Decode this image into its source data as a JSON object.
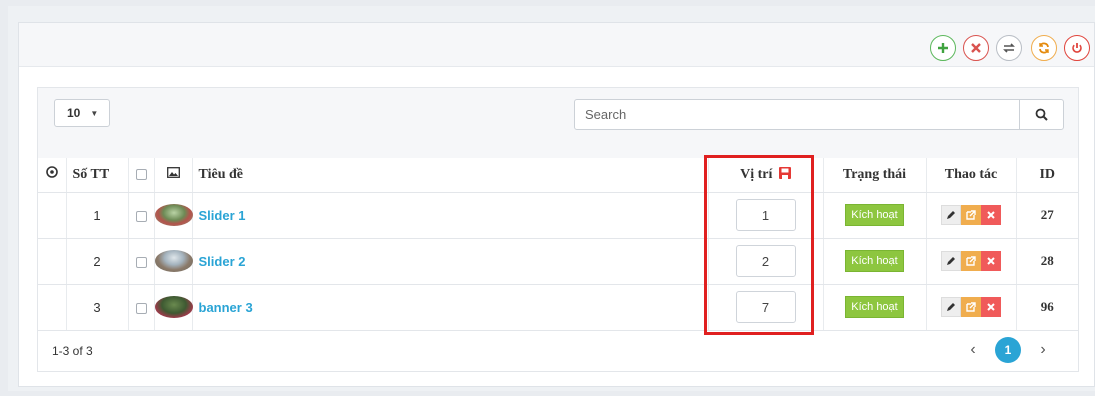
{
  "toolbar": {
    "buttons": [
      {
        "name": "add",
        "icon": "plus-icon"
      },
      {
        "name": "delete",
        "icon": "close-icon"
      },
      {
        "name": "swap",
        "icon": "swap-icon"
      },
      {
        "name": "refresh",
        "icon": "refresh-icon"
      },
      {
        "name": "power",
        "icon": "power-icon"
      }
    ]
  },
  "table_controls": {
    "page_size": "10",
    "search_placeholder": "Search"
  },
  "columns": {
    "no": "Số TT",
    "title": "Tiêu đề",
    "position": "Vị trí",
    "status": "Trạng thái",
    "actions": "Thao tác",
    "id": "ID"
  },
  "rows": [
    {
      "no": "1",
      "title": "Slider 1",
      "position": "1",
      "status": "Kích hoạt",
      "id": "27"
    },
    {
      "no": "2",
      "title": "Slider 2",
      "position": "2",
      "status": "Kích hoạt",
      "id": "28"
    },
    {
      "no": "3",
      "title": "banner 3",
      "position": "7",
      "status": "Kích hoạt",
      "id": "96"
    }
  ],
  "footer": {
    "count": "1-3 of 3",
    "current_page": "1"
  },
  "colors": {
    "link": "#2aa4d5",
    "status_active": "#8dc63f",
    "highlight": "#e02020"
  }
}
